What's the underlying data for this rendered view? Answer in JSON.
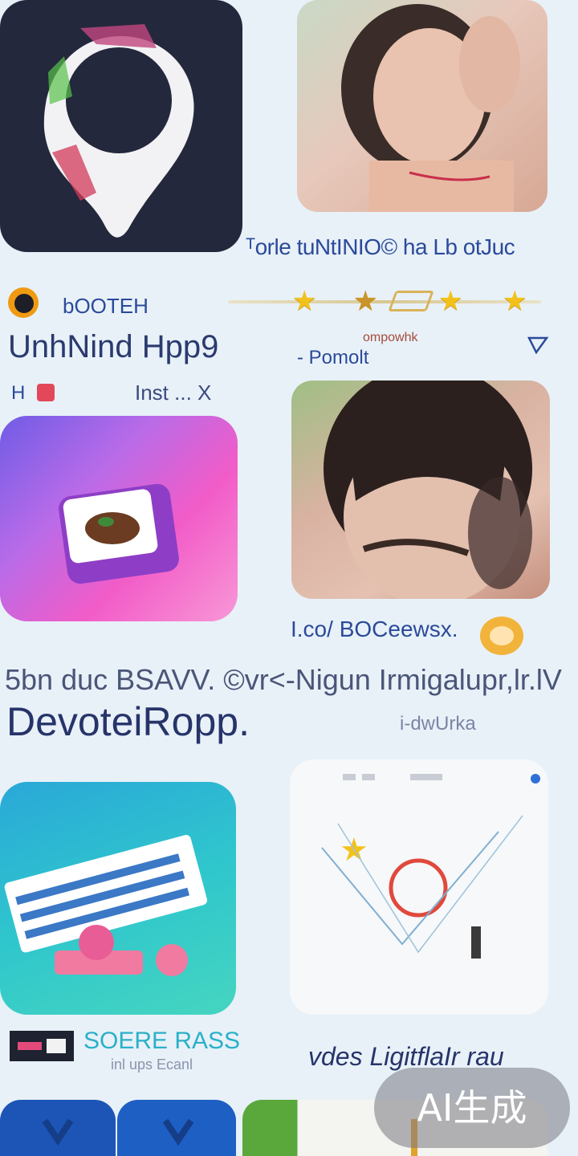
{
  "colors": {
    "background": "#e8f1f8",
    "text_dark": "#2a3350",
    "text_blue": "#2b4a9a",
    "star": "#f3c21a",
    "watermark_bg": "#78787e"
  },
  "tiles": [
    {
      "name": "app-tile-dark-logo",
      "icon": "location-pin-logo-icon"
    },
    {
      "name": "app-tile-photo-girl",
      "icon": "photo-thumbnail"
    },
    {
      "name": "app-tile-gradient-pink",
      "icon": "card-photo-icon"
    },
    {
      "name": "app-tile-photo-girl-2",
      "icon": "photo-thumbnail"
    },
    {
      "name": "app-tile-teal-ticket",
      "icon": "ticket-icon"
    },
    {
      "name": "app-tile-white-sketch",
      "icon": "sketch-icon"
    }
  ],
  "row1": {
    "caption": "ᵀorle tuNtINIO© ha Lb otJuc",
    "brand_label": "bOOTEH",
    "app_title": "UnhNind Hpp9",
    "meta_left": "H",
    "meta_mid": "Inst ... X",
    "rating_label_top": "ompowhk",
    "rating_label_bottom": "- Pomolt",
    "rating_stars": 4
  },
  "row2": {
    "caption": "I.co/ BOCeewsx.",
    "headline": "5bn duc BSAVV. ©vr<-Nigun Irmigalupr,lr.lV",
    "app_title": "DevoteiRopp.",
    "subtitle": "i-dwUrka"
  },
  "row3": {
    "brand_label": "SOERE RASS",
    "sub_label": "inl ups Ecanl",
    "caption": "vdes LigitflaIr rau"
  },
  "watermark": {
    "text": "AI生成"
  }
}
